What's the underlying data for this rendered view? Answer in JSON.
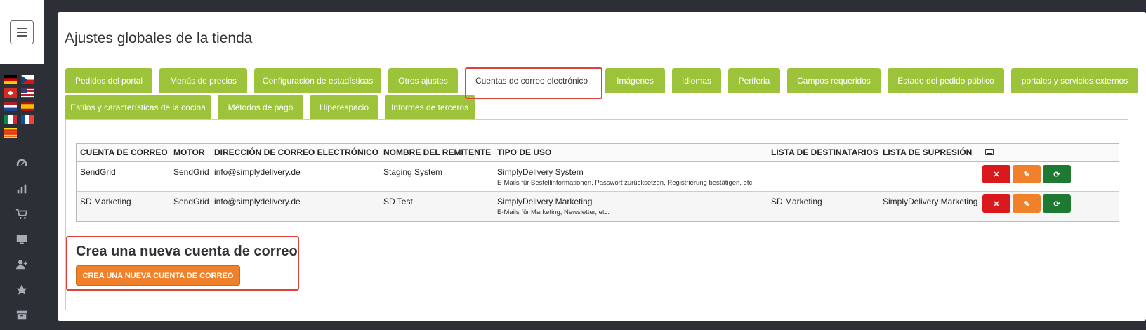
{
  "page": {
    "title": "Ajustes globales de la tienda"
  },
  "tabs_row1": [
    {
      "label": "Pedidos del portal"
    },
    {
      "label": "Menús de precios"
    },
    {
      "label": "Configuración de estadísticas"
    },
    {
      "label": "Otros ajustes"
    },
    {
      "label": "Cuentas de correo electrónico",
      "active": true
    },
    {
      "label": "Imágenes"
    },
    {
      "label": "Idiomas"
    },
    {
      "label": "Periferia"
    },
    {
      "label": "Campos requeridos"
    },
    {
      "label": "Estado del pedido público"
    },
    {
      "label": "portales y servicios externos"
    }
  ],
  "tabs_row2": [
    {
      "label": "Estilos y características de la cocina"
    },
    {
      "label": "Métodos de pago"
    },
    {
      "label": "Hiperespacio"
    },
    {
      "label": "Informes de terceros"
    }
  ],
  "table": {
    "headers": {
      "account": "CUENTA DE CORREO",
      "engine": "MOTOR",
      "email": "DIRECCIÓN DE CORREO ELECTRÓNICO",
      "sender": "NOMBRE DEL REMITENTE",
      "usage": "TIPO DE USO",
      "recipients": "LISTA DE DESTINATARIOS",
      "suppression": "LISTA DE SUPRESIÓN"
    },
    "rows": [
      {
        "account": "SendGrid",
        "engine": "SendGrid",
        "email": "info@simplydelivery.de",
        "sender": "Staging System",
        "usage": "SimplyDelivery System",
        "usage_detail": "E-Mails für Bestellinformationen, Passwort zurücksetzen, Registrierung bestätigen, etc.",
        "recipients": "",
        "suppression": ""
      },
      {
        "account": "SD Marketing",
        "engine": "SendGrid",
        "email": "info@simplydelivery.de",
        "sender": "SD Test",
        "usage": "SimplyDelivery Marketing",
        "usage_detail": "E-Mails für Marketing, Newsletter, etc.",
        "recipients": "SD Marketing",
        "suppression": "SimplyDelivery Marketing"
      }
    ],
    "actions": {
      "delete": "✕",
      "edit": "✎",
      "sync": "⟳"
    }
  },
  "create": {
    "title": "Crea una nueva cuenta de correo",
    "button": "CREA UNA NUEVA CUENTA DE CORREO"
  },
  "sidebar": {
    "flags": [
      "de-flag",
      "cz-flag",
      "ch-flag",
      "us-flag",
      "nl-flag",
      "es-flag",
      "it-flag",
      "fr-flag",
      "ca-flag"
    ],
    "icons": [
      "dashboard-icon",
      "bar-chart-icon",
      "shopping-cart-icon",
      "monitor-icon",
      "add-user-icon",
      "star-icon",
      "archive-icon"
    ]
  },
  "colors": {
    "tab_green": "#9dc33b",
    "orange": "#f0812a",
    "red": "#d9191e",
    "dark_green": "#1e7a32",
    "highlight": "#e0423a",
    "sidebar": "#2c2f36"
  }
}
